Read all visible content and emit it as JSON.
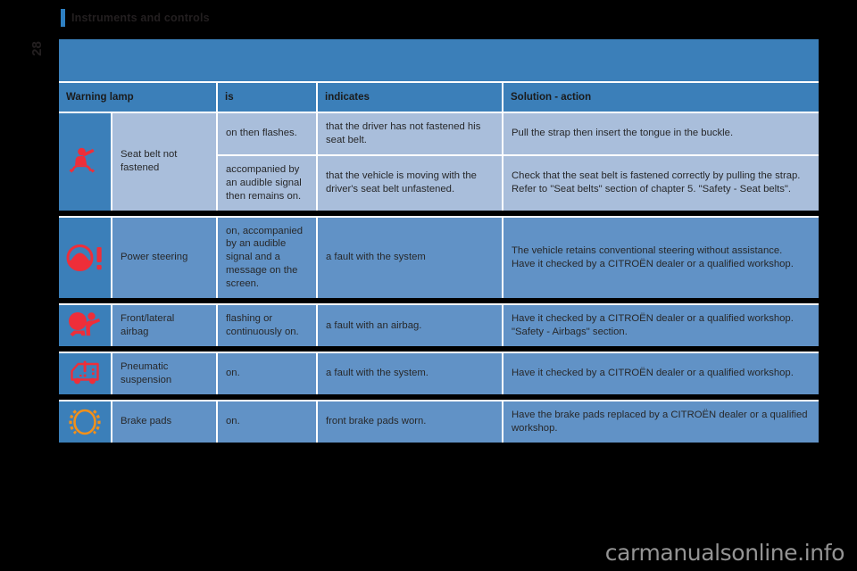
{
  "chapter": {
    "title": "Instruments and controls"
  },
  "folio": {
    "page_number": "28"
  },
  "table": {
    "headers": {
      "warning_lamp": "Warning lamp",
      "is": "is",
      "indicates": "indicates",
      "solution": "Solution - action"
    },
    "rows": [
      {
        "icon": "seat-belt-icon",
        "icon_color": "#ee2e39",
        "name": "Seat belt not\nfastened",
        "sub": [
          {
            "is": "on then flashes.",
            "indicates": "that the driver has not fastened his seat belt.",
            "solution": "Pull the strap then insert the tongue in the buckle."
          },
          {
            "is": "accompanied by an audible signal then remains on.",
            "indicates": "that the vehicle is moving with the driver's seat belt unfastened.",
            "solution": "Check that the seat belt is fastened correctly by pulling the strap. Refer to \"Seat belts\" section of chapter 5. \"Safety - Seat belts\"."
          }
        ]
      },
      {
        "icon": "power-steering-icon",
        "icon_color": "#ee2e39",
        "name": "Power steering",
        "sub": [
          {
            "is": "on, accompanied by an audible signal and a message on the screen.",
            "indicates": "a fault with the system",
            "solution": "The vehicle retains conventional steering without assistance.\nHave it checked by a CITROËN dealer or a qualified workshop."
          }
        ]
      },
      {
        "icon": "airbag-icon",
        "icon_color": "#ee2e39",
        "name": "Front/lateral\nairbag",
        "sub": [
          {
            "is": "flashing or continuously on.",
            "indicates": "a fault with an airbag.",
            "solution": "Have it checked by a CITROËN dealer or a qualified workshop.\n\"Safety - Airbags\" section."
          }
        ]
      },
      {
        "icon": "pneumatic-suspension-icon",
        "icon_color": "#ee2e39",
        "name": "Pneumatic\nsuspension",
        "sub": [
          {
            "is": "on.",
            "indicates": "a fault with the system.",
            "solution": "Have it checked by a CITROËN dealer or a qualified workshop."
          }
        ]
      },
      {
        "icon": "brake-pads-icon",
        "icon_color": "#f39019",
        "name": "Brake pads",
        "sub": [
          {
            "is": "on.",
            "indicates": "front brake pads worn.",
            "solution": "Have the brake pads replaced by a CITROËN dealer or a qualified workshop."
          }
        ]
      }
    ]
  },
  "watermark": {
    "text": "carmanualsonline.info"
  },
  "colors": {
    "header_blue": "#3b7fb9",
    "row_light": "#a9bedb",
    "row_mid": "#6192c6",
    "icon_red": "#ee2e39",
    "icon_orange": "#f39019",
    "page_bg": "#000000"
  }
}
